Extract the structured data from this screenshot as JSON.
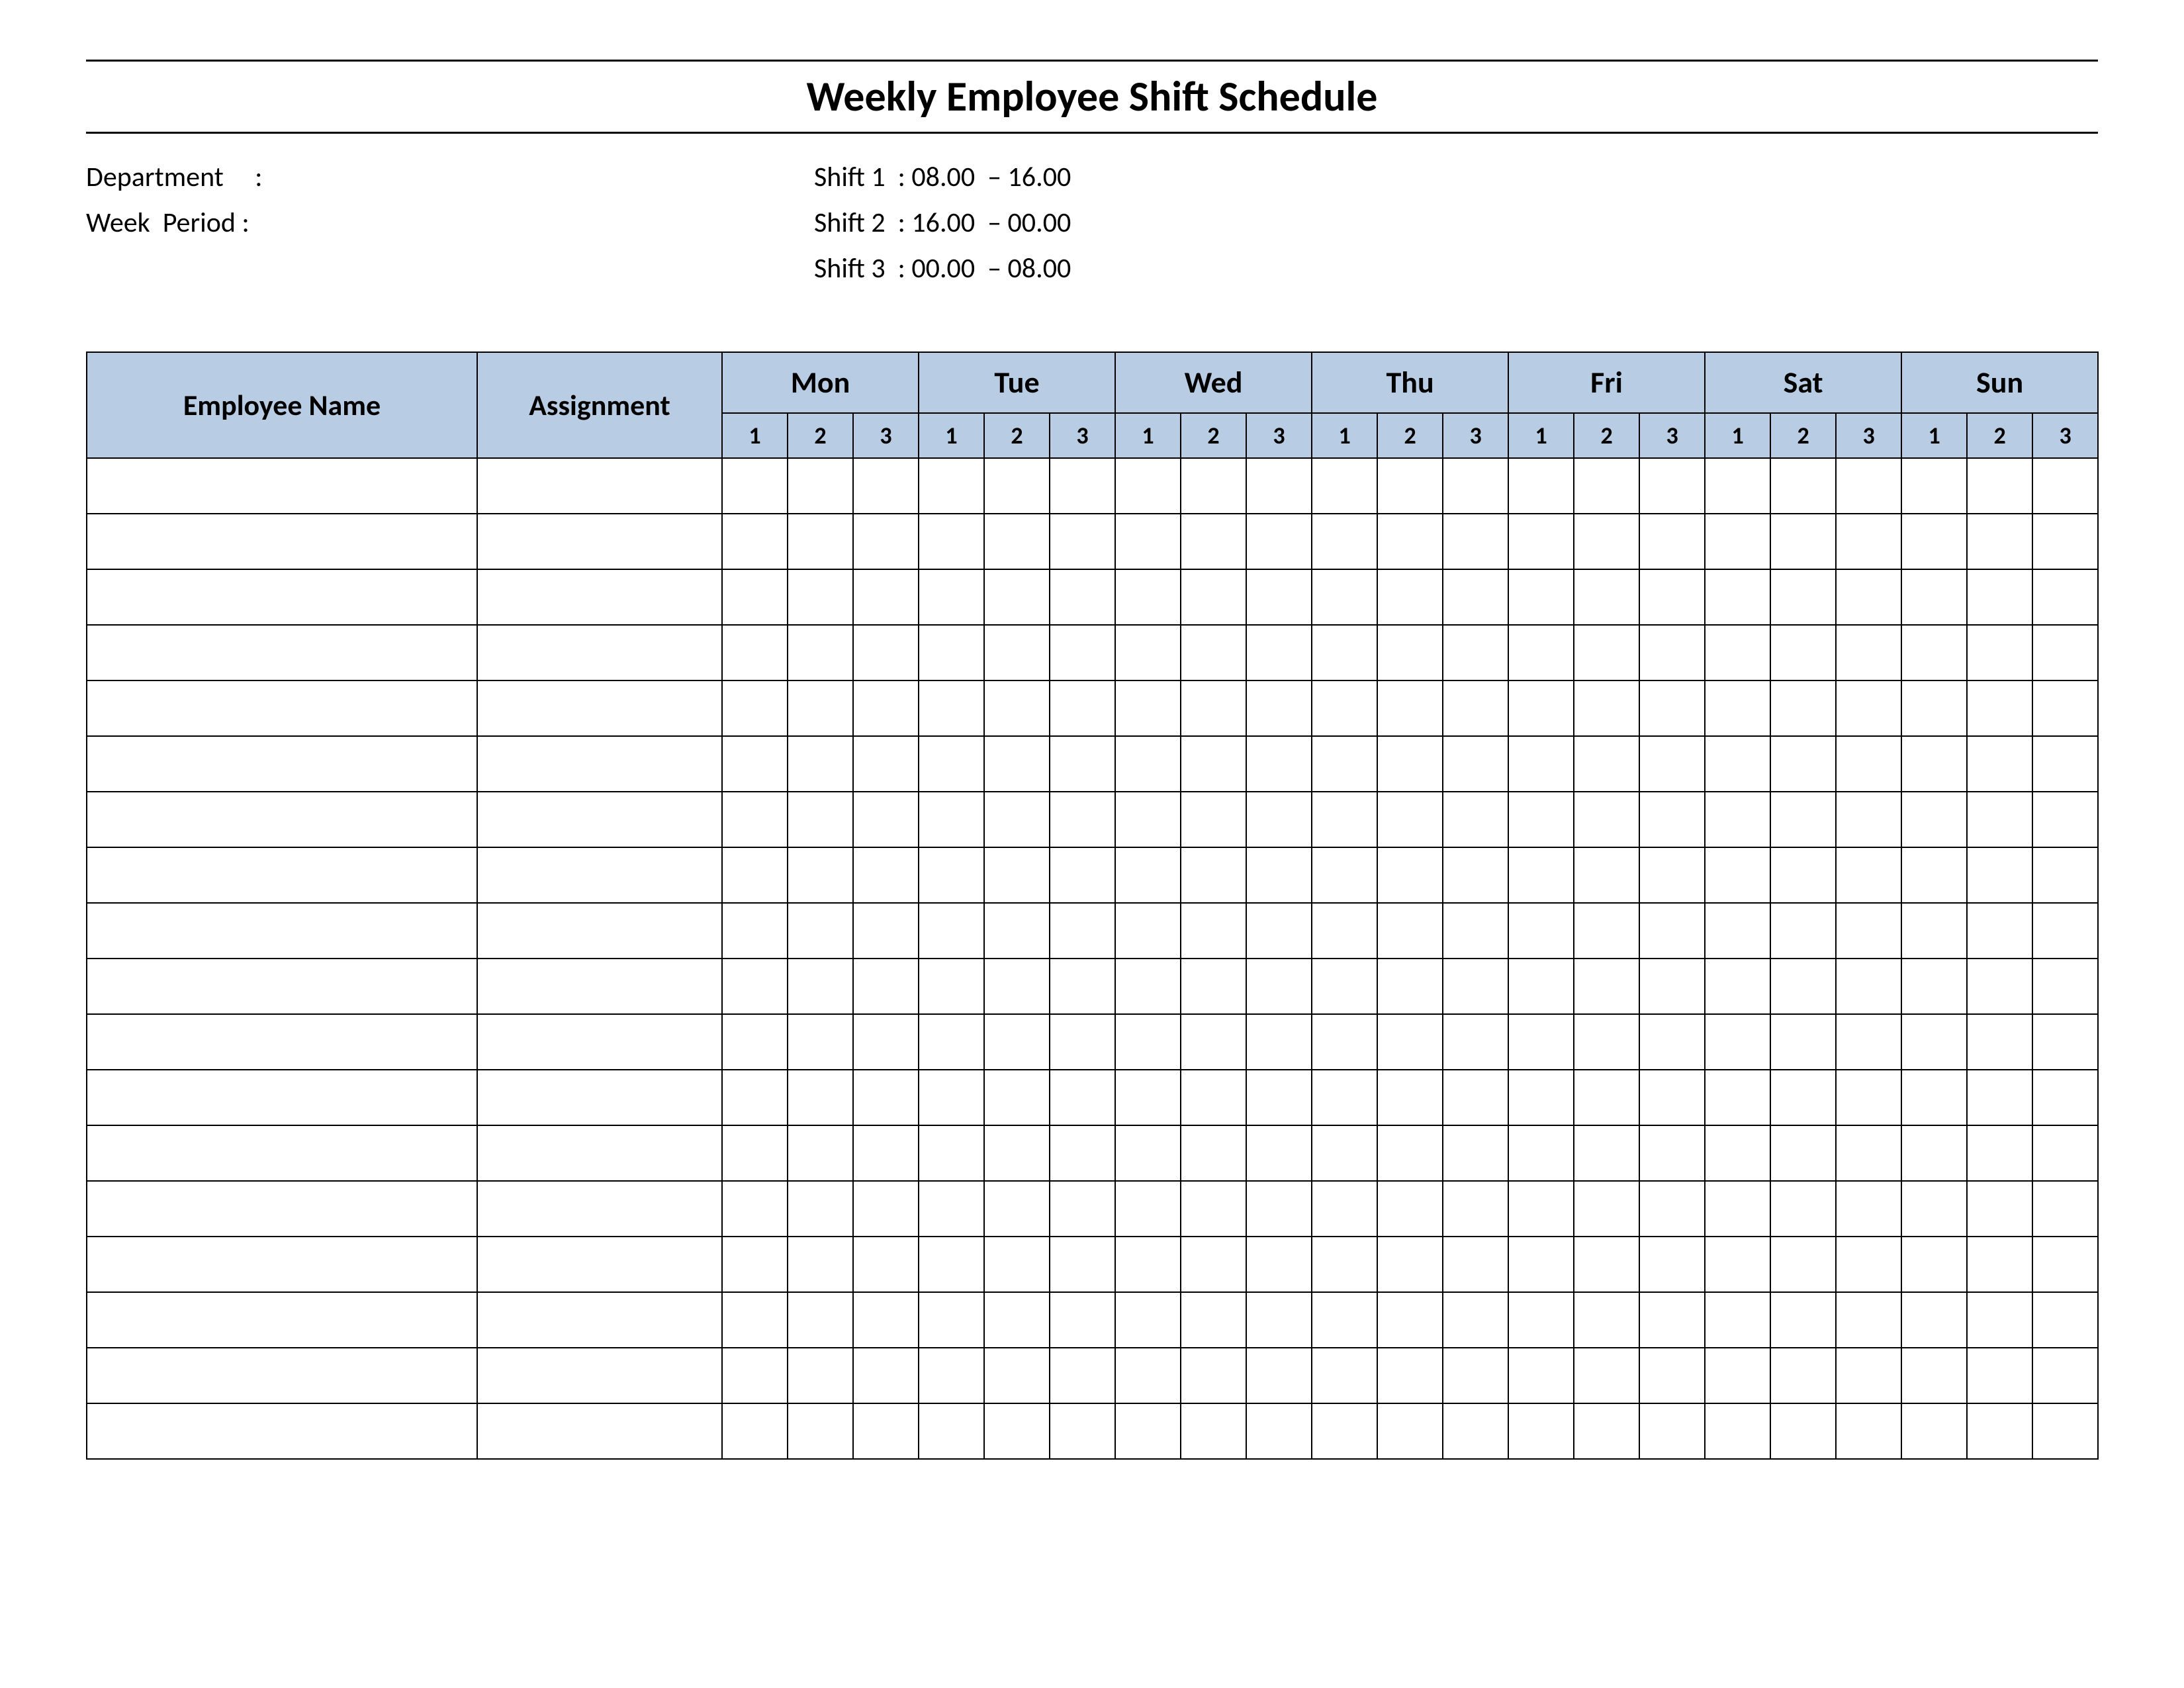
{
  "title": "Weekly Employee Shift Schedule",
  "meta": {
    "department_label": "Department     :",
    "week_period_label": "Week  Period :",
    "department_value": "",
    "week_period_value": "",
    "shift1": "Shift 1  : 08.00  – 16.00",
    "shift2": "Shift 2  : 16.00  – 00.00",
    "shift3": "Shift 3  : 00.00  – 08.00"
  },
  "columns": {
    "employee_name": "Employee Name",
    "assignment": "Assignment",
    "days": [
      "Mon",
      "Tue",
      "Wed",
      "Thu",
      "Fri",
      "Sat",
      "Sun"
    ],
    "shifts": [
      "1",
      "2",
      "3"
    ]
  },
  "row_count": 18
}
